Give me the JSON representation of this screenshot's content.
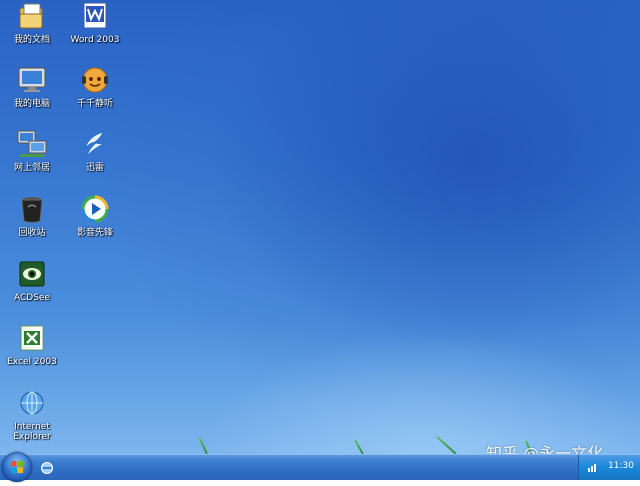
{
  "desktop": {
    "icons": [
      {
        "label": "我的文档",
        "icon": "my-documents-icon"
      },
      {
        "label": "Word 2003",
        "icon": "word-icon"
      },
      {
        "label": "我的电脑",
        "icon": "my-computer-icon"
      },
      {
        "label": "千千静听",
        "icon": "ttplayer-icon"
      },
      {
        "label": "网上邻居",
        "icon": "network-places-icon"
      },
      {
        "label": "迅雷",
        "icon": "thunder-icon"
      },
      {
        "label": "回收站",
        "icon": "recycle-bin-icon"
      },
      {
        "label": "影音先锋",
        "icon": "xfplay-icon"
      },
      {
        "label": "ACDSee",
        "icon": "acdsee-icon"
      },
      {
        "label": "Excel 2003",
        "icon": "excel-icon"
      },
      {
        "label": "Internet Explorer",
        "icon": "ie-icon"
      }
    ]
  },
  "taskbar": {
    "clock": "11:30"
  },
  "watermark": "知乎 @永一文化",
  "colors": {
    "desktop_top": "#2a62c4",
    "desktop_bottom": "#7db6ee",
    "taskbar": "#2f6fc4",
    "tray": "#1a87d8"
  }
}
